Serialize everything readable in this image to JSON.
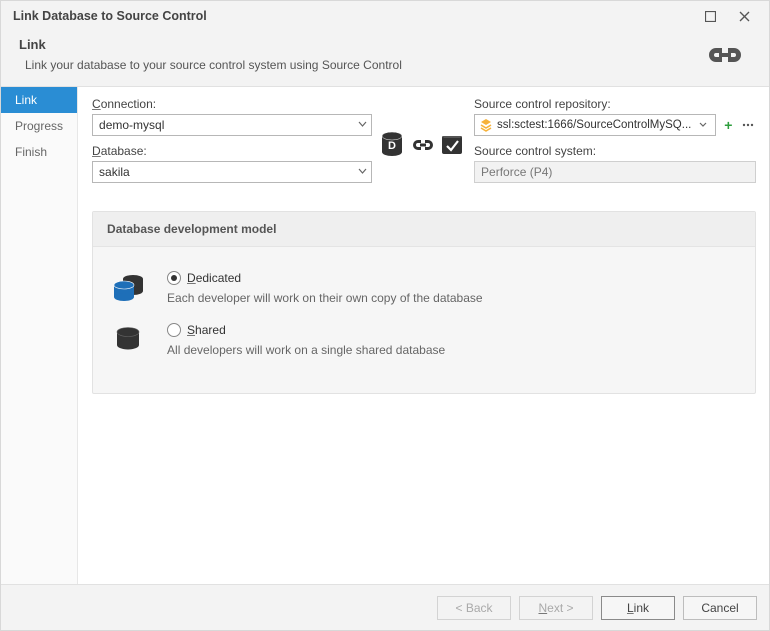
{
  "window": {
    "title": "Link Database to Source Control"
  },
  "header": {
    "title": "Link",
    "subtitle": "Link your database to your source control system using Source Control"
  },
  "sidebar": {
    "steps": [
      "Link",
      "Progress",
      "Finish"
    ],
    "active_index": 0
  },
  "form": {
    "connection_label": "Connection:",
    "connection_value": "demo-mysql",
    "database_label": "Database:",
    "database_value": "sakila",
    "repo_label": "Source control repository:",
    "repo_value": "ssl:sctest:1666/SourceControlMySQ...",
    "scs_label": "Source control system:",
    "scs_value": "Perforce (P4)"
  },
  "panel": {
    "title": "Database development model",
    "dedicated": {
      "label": "Dedicated",
      "desc": "Each developer will work on their own copy of the database"
    },
    "shared": {
      "label": "Shared",
      "desc": "All developers will work on a single shared database"
    },
    "selected": "dedicated"
  },
  "footer": {
    "back": "< Back",
    "next": "Next >",
    "link": "Link",
    "cancel": "Cancel"
  }
}
